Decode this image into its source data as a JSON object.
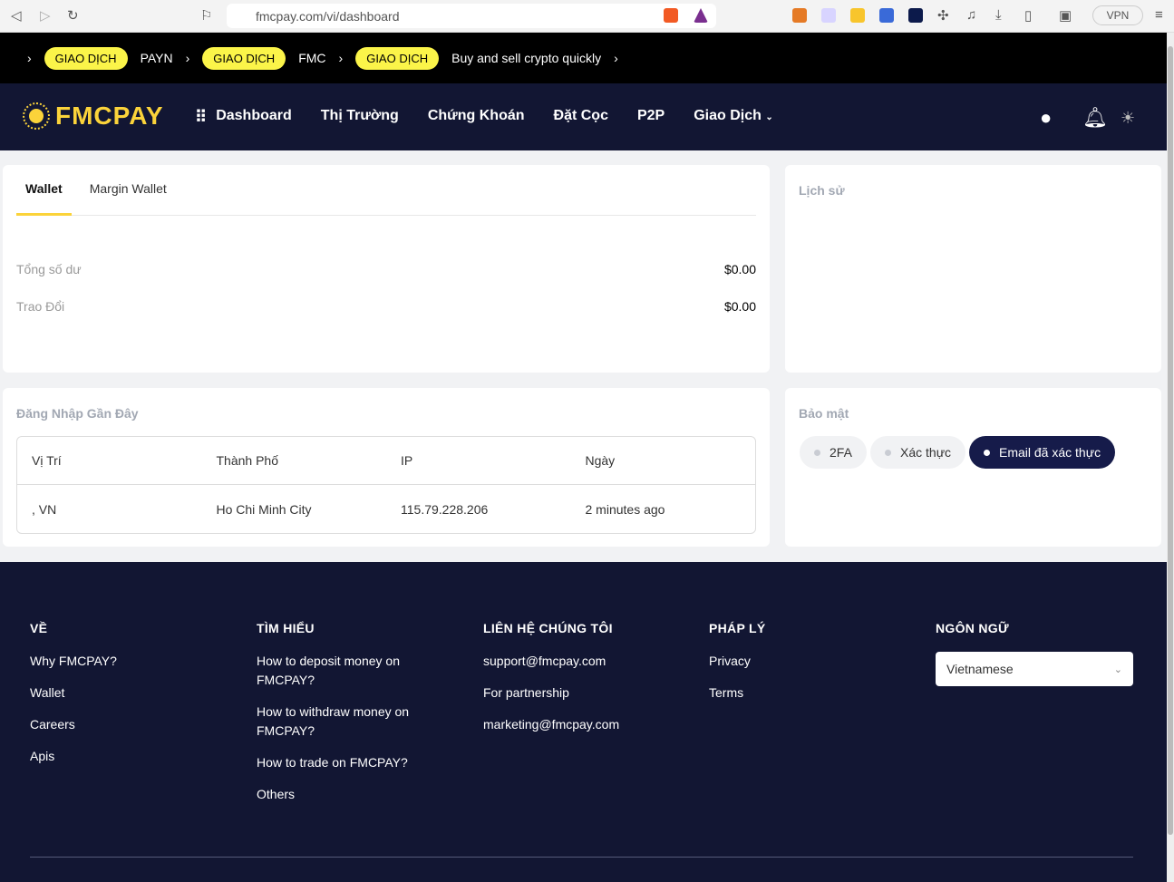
{
  "browser": {
    "url": "fmcpay.com/vi/dashboard",
    "vpn": "VPN"
  },
  "ticker": [
    {
      "badge": "GIAO DỊCH",
      "text": "PAYN"
    },
    {
      "badge": "GIAO DỊCH",
      "text": "FMC"
    },
    {
      "badge": "GIAO DỊCH",
      "text": "Buy and sell crypto quickly"
    }
  ],
  "nav": {
    "logo": "FMCPAY",
    "items": [
      "Dashboard",
      "Thị Trường",
      "Chứng Khoán",
      "Đặt Cọc",
      "P2P",
      "Giao Dịch"
    ]
  },
  "wallet": {
    "tabs": [
      "Wallet",
      "Margin Wallet"
    ],
    "rows": [
      {
        "label": "Tổng số dư",
        "value": "$0.00"
      },
      {
        "label": "Trao Đổi",
        "value": "$0.00"
      }
    ]
  },
  "history": {
    "title": "Lịch sử"
  },
  "logins": {
    "title": "Đăng Nhập Gần Đây",
    "headers": [
      "Vị Trí",
      "Thành Phố",
      "IP",
      "Ngày"
    ],
    "rows": [
      [
        ", VN",
        "Ho Chi Minh City",
        "115.79.228.206",
        "2 minutes ago"
      ]
    ]
  },
  "security": {
    "title": "Bảo mật",
    "chips": [
      "2FA",
      "Xác thực",
      "Email đã xác thực"
    ]
  },
  "footer": {
    "cols": [
      {
        "title": "VỀ",
        "links": [
          "Why FMCPAY?",
          "Wallet",
          "Careers",
          "Apis"
        ]
      },
      {
        "title": "TÌM HIỂU",
        "links": [
          "How to deposit money on FMCPAY?",
          "How to withdraw money on FMCPAY?",
          "How to trade on FMCPAY?",
          "Others"
        ]
      },
      {
        "title": "LIÊN HỆ CHÚNG TÔI",
        "links": [
          "support@fmcpay.com",
          "For partnership",
          "marketing@fmcpay.com"
        ]
      },
      {
        "title": "PHÁP LÝ",
        "links": [
          "Privacy",
          "Terms"
        ]
      }
    ],
    "language": {
      "title": "NGÔN NGỮ",
      "selected": "Vietnamese"
    }
  }
}
